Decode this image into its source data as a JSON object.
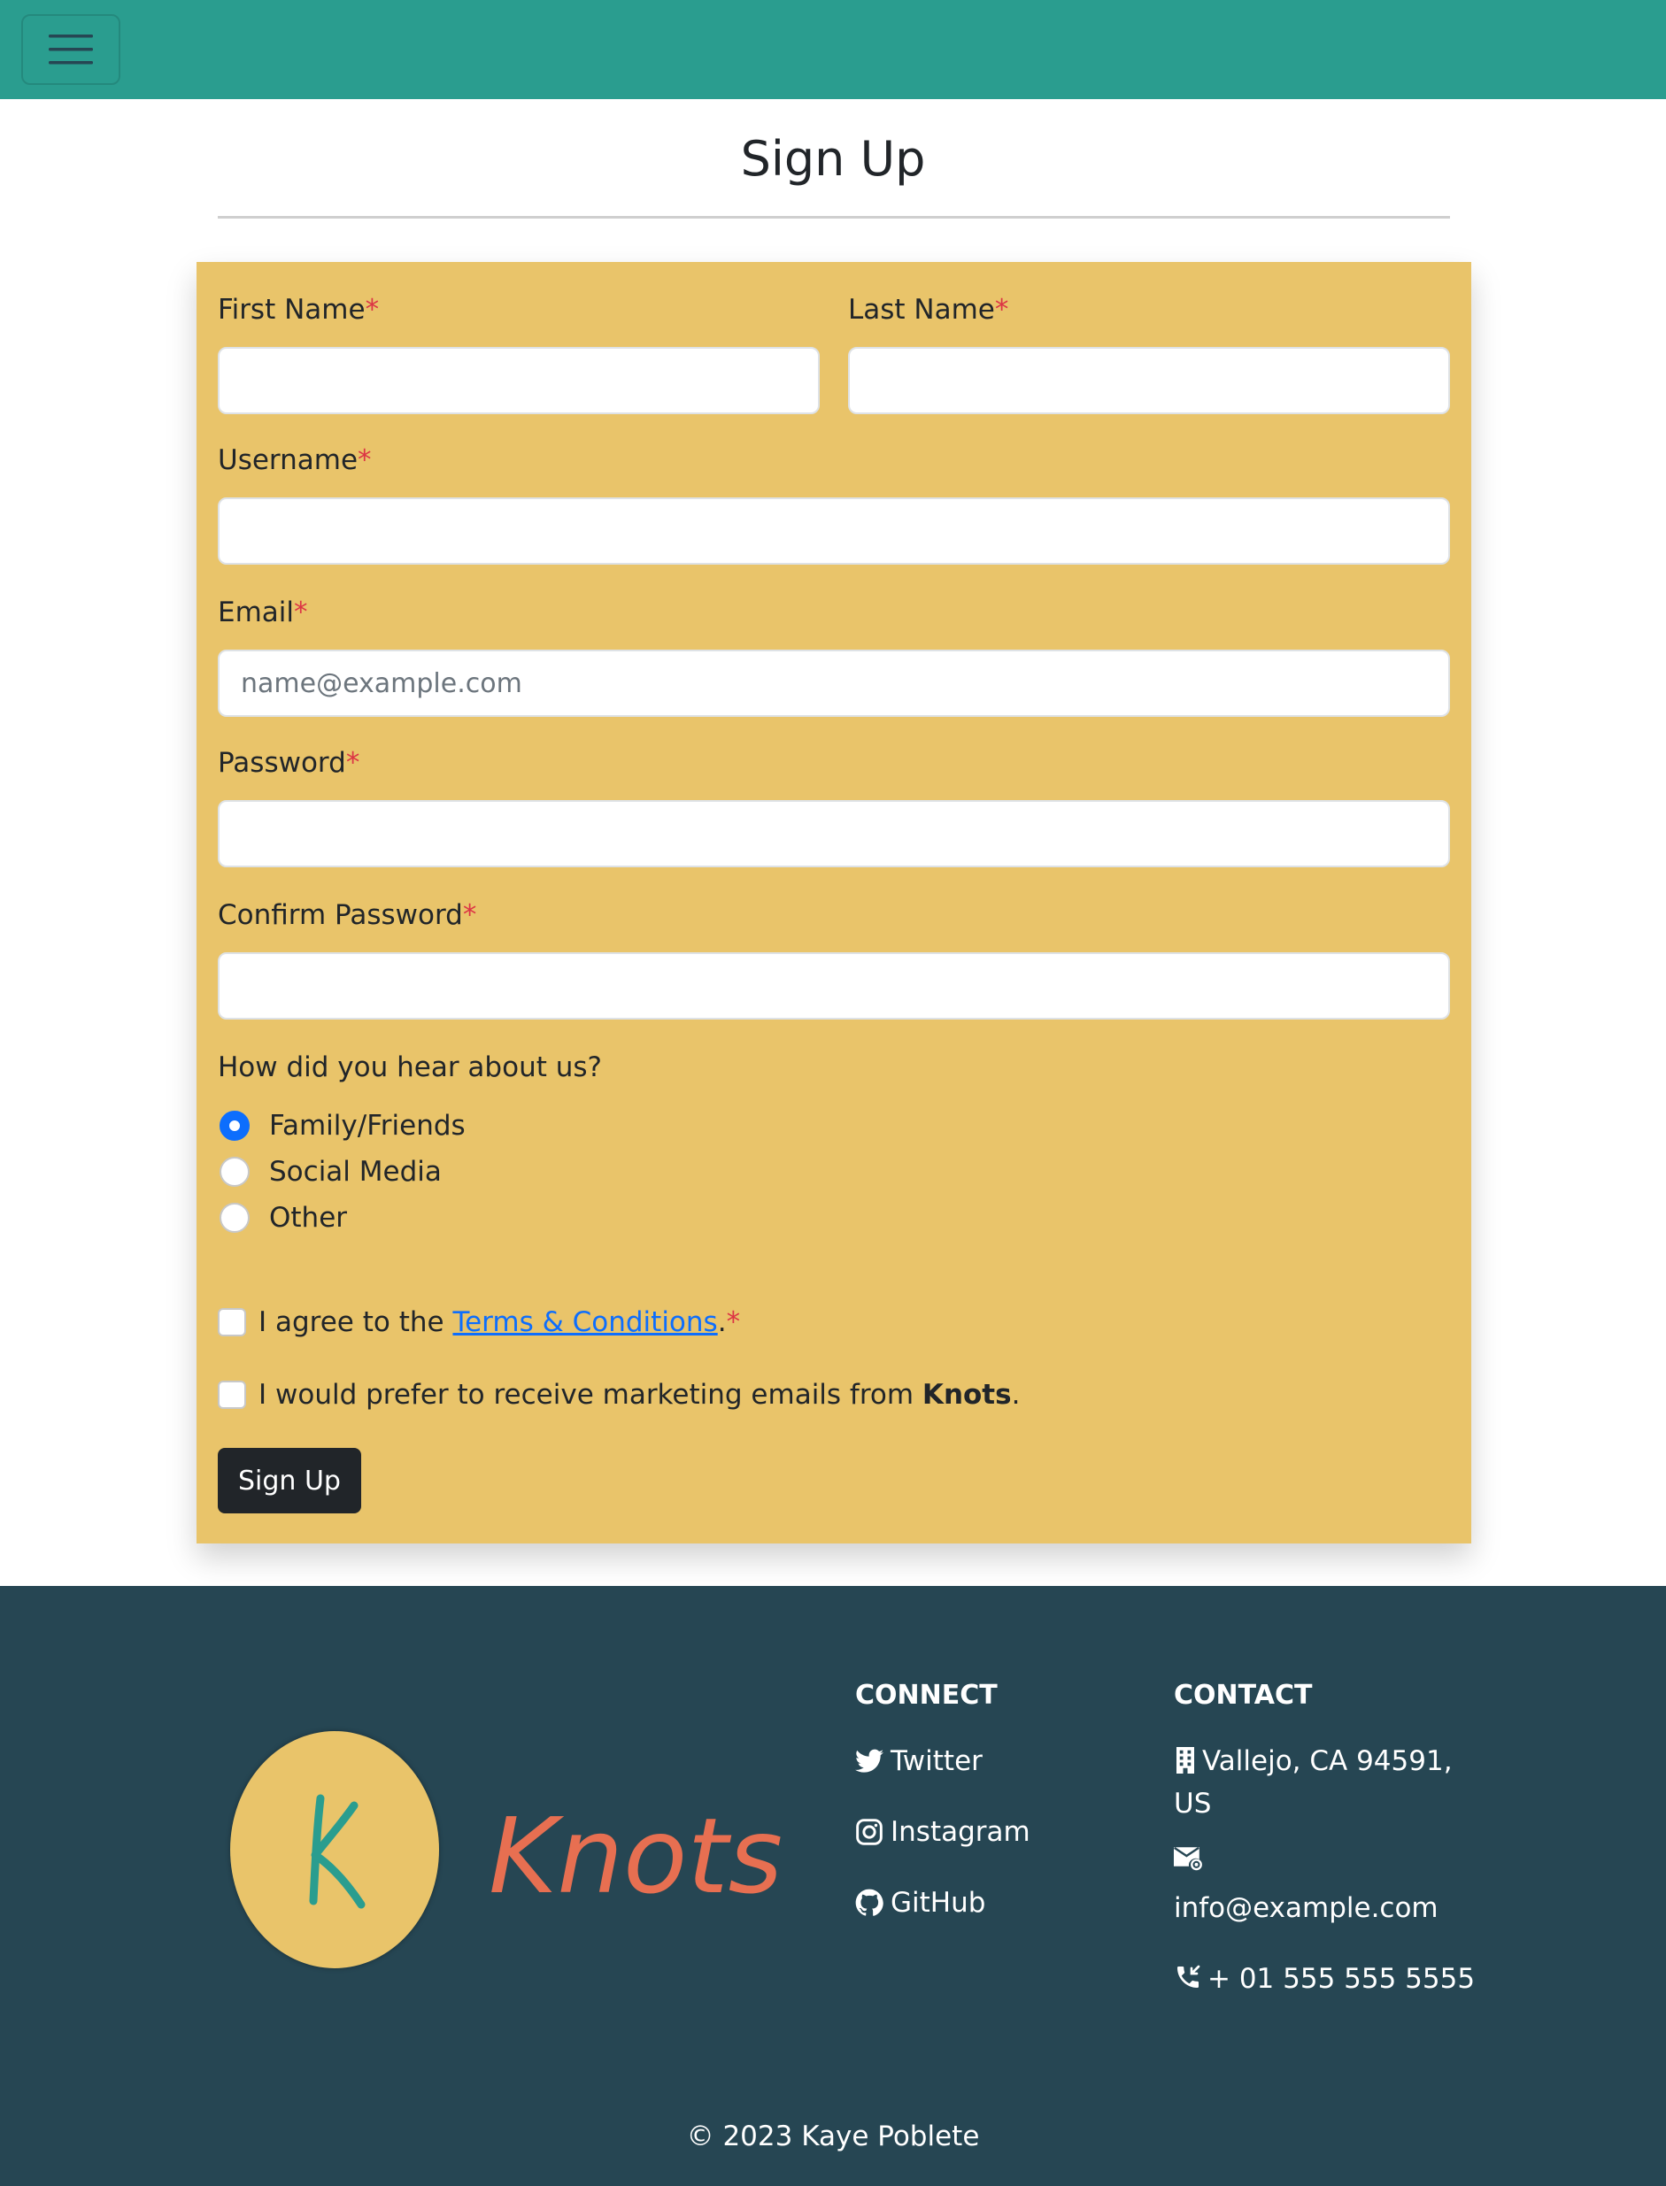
{
  "theme": {
    "nav_bg": "#2a9d8f",
    "card_bg": "#e9c46a",
    "footer_bg": "#264653",
    "accent": "#0d6efd",
    "required": "#dc3545",
    "logo_k_color": "#2a9d8f",
    "logo_word_color": "#e76f51"
  },
  "navbar": {
    "toggle_icon": "hamburger-icon"
  },
  "page": {
    "title": "Sign Up"
  },
  "form": {
    "required_mark": "*",
    "first_name": {
      "label": "First Name",
      "value": ""
    },
    "last_name": {
      "label": "Last Name",
      "value": ""
    },
    "username": {
      "label": "Username",
      "value": ""
    },
    "email": {
      "label": "Email",
      "value": "",
      "placeholder": "name@example.com"
    },
    "password": {
      "label": "Password",
      "value": ""
    },
    "confirm_password": {
      "label": "Confirm Password",
      "value": ""
    },
    "hear_about": {
      "question": "How did you hear about us?",
      "options": [
        {
          "label": "Family/Friends",
          "checked": true
        },
        {
          "label": "Social Media",
          "checked": false
        },
        {
          "label": "Other",
          "checked": false
        }
      ]
    },
    "terms": {
      "prefix": "I agree to the ",
      "link": "Terms & Conditions",
      "suffix": ".",
      "checked": false
    },
    "marketing": {
      "prefix": "I would prefer to receive marketing emails from ",
      "brand": "Knots",
      "suffix": ".",
      "checked": false
    },
    "submit_label": "Sign Up"
  },
  "footer": {
    "logo": {
      "letter": "K",
      "wordmark": "Knots"
    },
    "connect": {
      "heading": "CONNECT",
      "links": [
        {
          "icon": "twitter-icon",
          "label": "Twitter"
        },
        {
          "icon": "instagram-icon",
          "label": "Instagram"
        },
        {
          "icon": "github-icon",
          "label": "GitHub"
        }
      ]
    },
    "contact": {
      "heading": "CONTACT",
      "address_line1": "Vallejo, CA 94591,",
      "address_line2": "US",
      "email": "info@example.com",
      "phone": "+ 01 555 555 5555"
    },
    "copyright": "© 2023 Kaye Poblete"
  }
}
